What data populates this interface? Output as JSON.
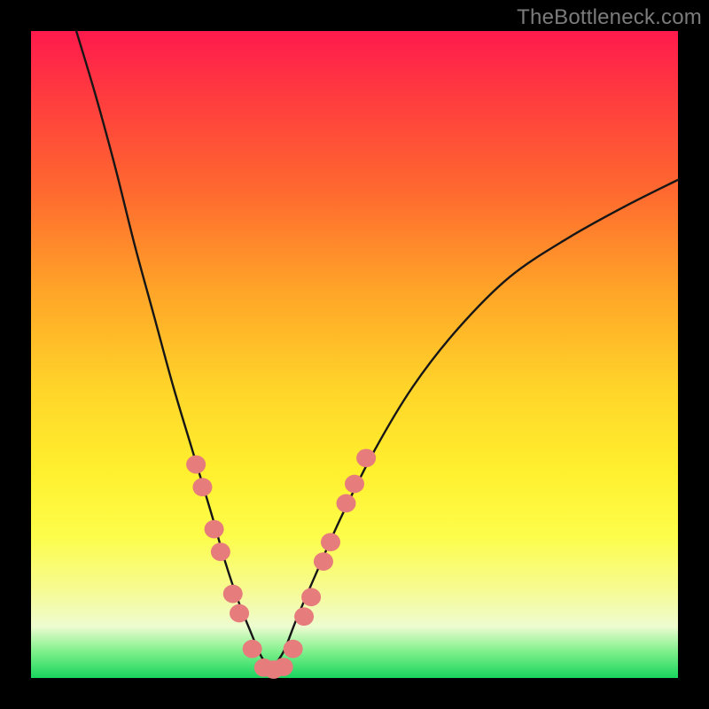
{
  "watermark": {
    "text": "TheBottleneck.com"
  },
  "colors": {
    "frame_bg": "#000000",
    "curve_stroke": "#161616",
    "marker_fill": "#e77c7d",
    "marker_stroke": "#d76a6b"
  },
  "chart_data": {
    "type": "line",
    "title": "",
    "xlabel": "",
    "ylabel": "",
    "xlim": [
      0,
      100
    ],
    "ylim": [
      0,
      100
    ],
    "grid": false,
    "series": [
      {
        "name": "left-branch",
        "x": [
          7,
          10,
          13,
          16,
          19,
          22,
          25,
          28,
          30,
          32,
          34,
          35.5,
          37
        ],
        "values": [
          100,
          90,
          79,
          67,
          56,
          45,
          35,
          25,
          18,
          12,
          7,
          3.5,
          1.2
        ]
      },
      {
        "name": "right-branch",
        "x": [
          37,
          39,
          41,
          44,
          48,
          53,
          59,
          66,
          74,
          83,
          92,
          100
        ],
        "values": [
          1.2,
          4,
          9,
          16,
          25,
          35,
          45,
          54,
          62,
          68,
          73,
          77
        ]
      }
    ],
    "markers": [
      {
        "x": 25.5,
        "y": 33
      },
      {
        "x": 26.5,
        "y": 29.5
      },
      {
        "x": 28.3,
        "y": 23
      },
      {
        "x": 29.3,
        "y": 19.5
      },
      {
        "x": 31.2,
        "y": 13
      },
      {
        "x": 32.2,
        "y": 10
      },
      {
        "x": 34.2,
        "y": 4.5
      },
      {
        "x": 36,
        "y": 1.6
      },
      {
        "x": 37.5,
        "y": 1.3
      },
      {
        "x": 39,
        "y": 1.7
      },
      {
        "x": 40.5,
        "y": 4.5
      },
      {
        "x": 42.2,
        "y": 9.5
      },
      {
        "x": 43.3,
        "y": 12.5
      },
      {
        "x": 45.2,
        "y": 18
      },
      {
        "x": 46.3,
        "y": 21
      },
      {
        "x": 48.7,
        "y": 27
      },
      {
        "x": 50,
        "y": 30
      },
      {
        "x": 51.8,
        "y": 34
      }
    ],
    "marker_radius_px": 11
  }
}
